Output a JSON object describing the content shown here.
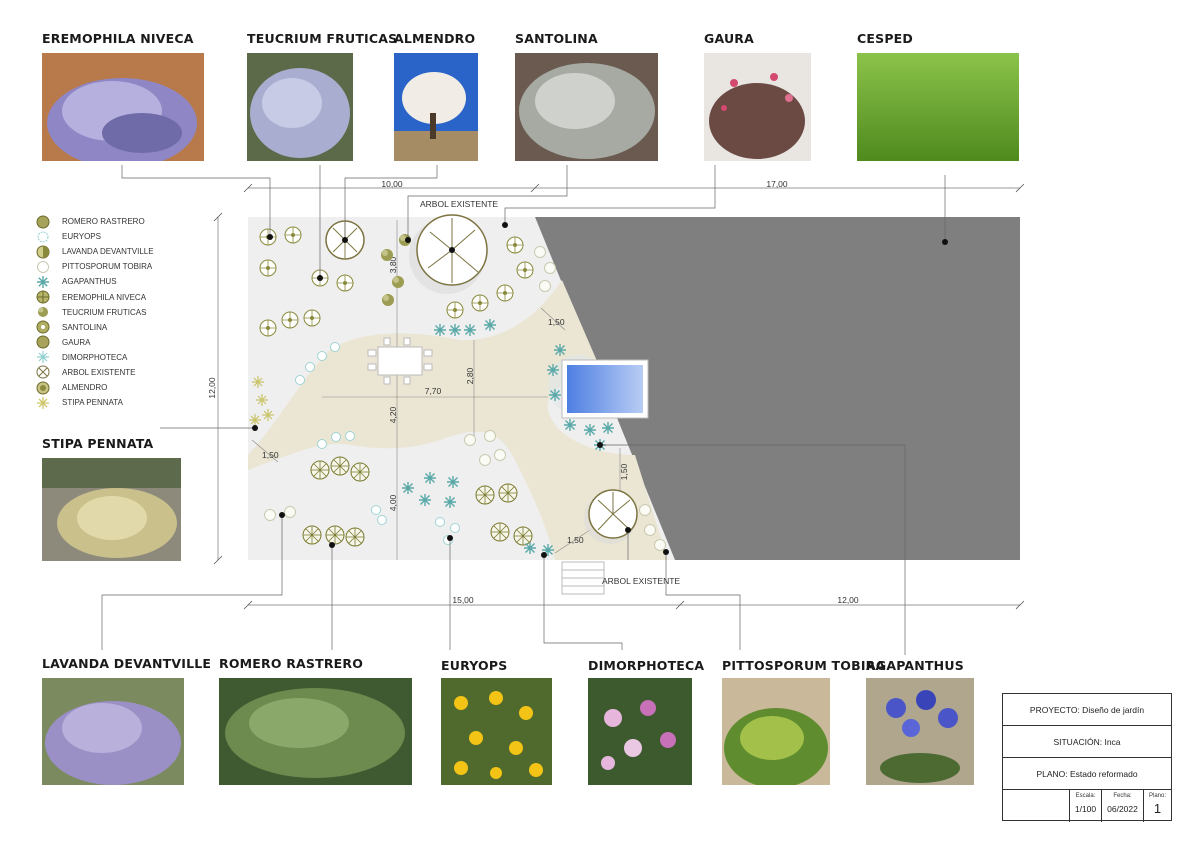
{
  "plants_top": [
    {
      "name": "EREMOPHILA NIVECA"
    },
    {
      "name": "TEUCRIUM FRUTICAS"
    },
    {
      "name": "ALMENDRO"
    },
    {
      "name": "SANTOLINA"
    },
    {
      "name": "GAURA"
    },
    {
      "name": "CESPED"
    }
  ],
  "plant_left": {
    "name": "STIPA PENNATA"
  },
  "plants_bottom": [
    {
      "name": "LAVANDA DEVANTVILLE"
    },
    {
      "name": "ROMERO RASTRERO"
    },
    {
      "name": "EURYOPS"
    },
    {
      "name": "DIMORPHOTECA"
    },
    {
      "name": "PITTOSPORUM TOBIRA"
    },
    {
      "name": "AGAPANTHUS"
    }
  ],
  "legend": [
    {
      "label": "ROMERO RASTRERO",
      "icon": "romero-symbol"
    },
    {
      "label": "EURYOPS",
      "icon": "euryops-symbol"
    },
    {
      "label": "LAVANDA DEVANTVILLE",
      "icon": "lavanda-symbol"
    },
    {
      "label": "PITTOSPORUM TOBIRA",
      "icon": "pittosporum-symbol"
    },
    {
      "label": "AGAPANTHUS",
      "icon": "agapanthus-symbol"
    },
    {
      "label": "EREMOPHILA NIVECA",
      "icon": "eremophila-symbol"
    },
    {
      "label": "TEUCRIUM FRUTICAS",
      "icon": "teucrium-symbol"
    },
    {
      "label": "SANTOLINA",
      "icon": "santolina-symbol"
    },
    {
      "label": "GAURA",
      "icon": "gaura-symbol"
    },
    {
      "label": "DIMORPHOTECA",
      "icon": "dimorphoteca-symbol"
    },
    {
      "label": "ARBOL EXISTENTE",
      "icon": "arbol-symbol"
    },
    {
      "label": "ALMENDRO",
      "icon": "almendro-symbol"
    },
    {
      "label": "STIPA PENNATA",
      "icon": "stipa-symbol"
    }
  ],
  "plan": {
    "arbol_top_label": "ARBOL EXISTENTE",
    "arbol_bottom_label": "ARBOL EXISTENTE",
    "dims": {
      "top_left": "10,00",
      "top_right": "17,00",
      "bottom_left": "15,00",
      "bottom_right": "12,00",
      "left_height": "12,00",
      "path_top": "3,80",
      "path_vertical_a": "2,80",
      "path_width": "7,70",
      "path_vertical_b": "4,20",
      "path_vertical_c": "4,00",
      "offset_a": "1,50",
      "offset_b": "1,50",
      "offset_c": "1,50",
      "offset_d": "1,50"
    },
    "colors": {
      "lawn": "#7f7f7f",
      "path": "#ece7d6",
      "ground": "#f1f1f1",
      "pool": "#5d8de8",
      "plant": "#8a8a3c"
    }
  },
  "titleblock": {
    "proyecto": "PROYECTO: Diseño de jardín",
    "situacion": "SITUACIÓN: Inca",
    "plano": "PLANO: Estado reformado",
    "escala_label": "Escala:",
    "escala": "1/100",
    "fecha_label": "Fecha:",
    "fecha": "06/2022",
    "plano_label": "Plano:",
    "plano_num": "1"
  }
}
